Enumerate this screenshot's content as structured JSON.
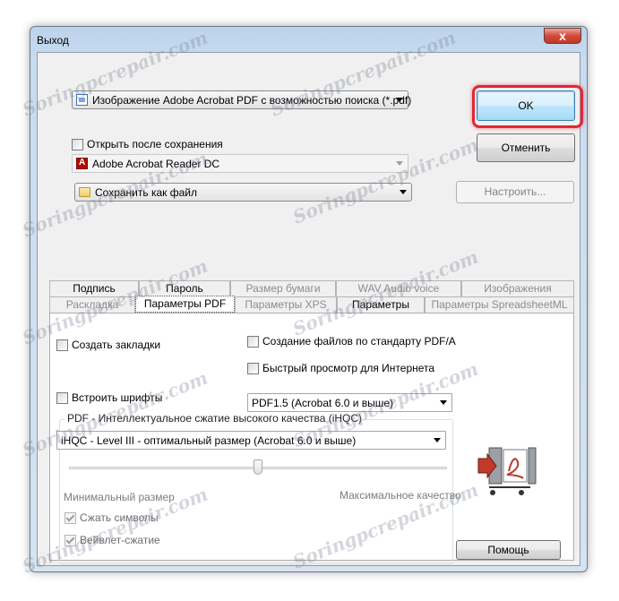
{
  "window": {
    "title": "Выход",
    "close_glyph": "x"
  },
  "format_combo": {
    "value": "Изображение Adobe Acrobat PDF с возможностью поиска (*.pdf)",
    "icon": "pdf-document-icon"
  },
  "open_after_save": {
    "label": "Открыть после сохранения",
    "checked": false
  },
  "viewer_combo": {
    "value": "Adobe Acrobat Reader DC",
    "icon": "acrobat-reader-icon",
    "enabled": false
  },
  "save_mode_combo": {
    "value": "Сохранить как файл",
    "icon": "folder-icon"
  },
  "buttons": {
    "ok": "OK",
    "cancel": "Отменить",
    "configure": "Настроить...",
    "help": "Помощь"
  },
  "tabs_row1": [
    {
      "label": "Подпись",
      "enabled": true
    },
    {
      "label": "Пароль",
      "enabled": true
    },
    {
      "label": "Размер бумаги",
      "enabled": false
    },
    {
      "label": "WAV Audio voice",
      "enabled": false
    },
    {
      "label": "Изображения",
      "enabled": false
    }
  ],
  "tabs_row2": [
    {
      "label": "Раскладка",
      "enabled": false
    },
    {
      "label": "Параметры PDF",
      "enabled": true,
      "active": true
    },
    {
      "label": "Параметры XPS",
      "enabled": false
    },
    {
      "label": "Параметры",
      "enabled": true
    },
    {
      "label": "Параметры SpreadsheetML",
      "enabled": false
    }
  ],
  "pdf_options": {
    "create_bookmarks": {
      "label": "Создать закладки",
      "checked": false
    },
    "pdfa": {
      "label": "Создание файлов по стандарту PDF/A",
      "checked": false
    },
    "fast_web_view": {
      "label": "Быстрый просмотр для Интернета",
      "checked": false
    },
    "embed_fonts": {
      "label": "Встроить шрифты",
      "checked": false
    },
    "pdf_version": {
      "value": "PDF1.5 (Acrobat 6.0 и выше)"
    },
    "ihqc": {
      "group_label": "PDF - Интеллектуальное сжатие высокого качества (iHQC)",
      "level": "iHQC - Level III - оптимальный размер (Acrobat 6.0 и выше)",
      "slider_min_label": "Минимальный размер",
      "slider_max_label": "Максимальное качество",
      "slider_value_fraction": 0.5,
      "compress_symbols": {
        "label": "Сжать символы",
        "checked": true,
        "enabled": false
      },
      "wavelet": {
        "label": "Вейвлет-сжатие",
        "checked": true,
        "enabled": false
      }
    }
  },
  "watermark": "Soringpcrepair.com",
  "colors": {
    "highlight": "#e32636",
    "title_bar": "#c9dcef",
    "close_button": "#d4493a"
  }
}
